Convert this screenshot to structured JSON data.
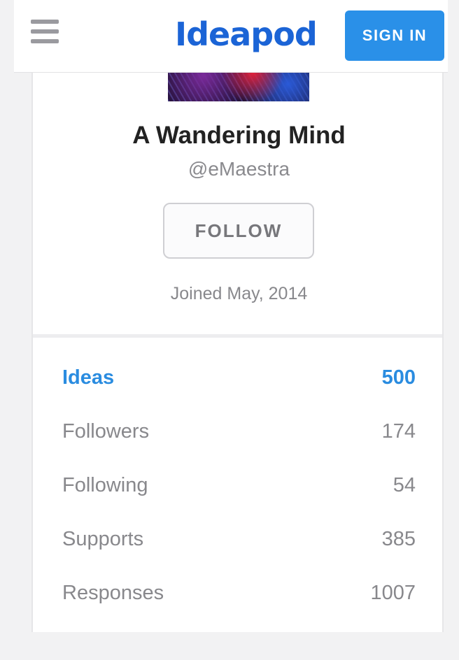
{
  "header": {
    "logo": "Ideapod",
    "signin_label": "SIGN IN"
  },
  "profile": {
    "name": "A Wandering Mind",
    "handle": "@eMaestra",
    "follow_label": "FOLLOW",
    "joined": "Joined May, 2014"
  },
  "stats": [
    {
      "label": "Ideas",
      "value": "500",
      "active": true
    },
    {
      "label": "Followers",
      "value": "174",
      "active": false
    },
    {
      "label": "Following",
      "value": "54",
      "active": false
    },
    {
      "label": "Supports",
      "value": "385",
      "active": false
    },
    {
      "label": "Responses",
      "value": "1007",
      "active": false
    }
  ],
  "colors": {
    "brand": "#1b64d6",
    "accent": "#2a90e8",
    "active_stat": "#2a8ce0",
    "muted_text": "#88888c"
  },
  "icons": [
    "hamburger-menu-icon"
  ]
}
